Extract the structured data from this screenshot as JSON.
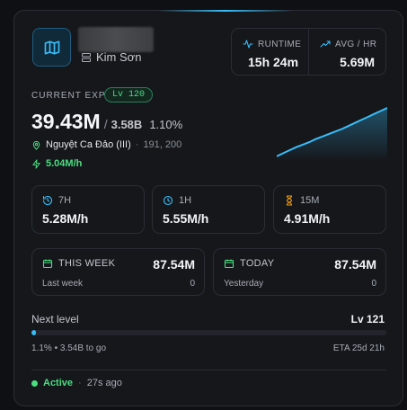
{
  "header": {
    "server_name": "Kim Sơn",
    "icons": {
      "map": "map-icon",
      "server": "server-icon"
    }
  },
  "stats": {
    "runtime_label": "RUNTIME",
    "runtime_value": "15h 24m",
    "avg_label": "AVG / HR",
    "avg_value": "5.69M"
  },
  "exp": {
    "label": "CURRENT EXP",
    "level": "Lv 120",
    "value": "39.43M",
    "slash": "/",
    "max": "3.58B",
    "percent": "1.10%",
    "location": "Nguyệt Ca Đảo (III)",
    "dot": "·",
    "coords": "191, 200",
    "rate": "5.04M/h"
  },
  "sparkline_values": [
    0.04,
    0.1,
    0.16,
    0.22,
    0.27,
    0.32,
    0.38,
    0.43,
    0.48,
    0.53,
    0.58,
    0.64,
    0.7,
    0.76,
    0.82,
    0.88,
    0.94,
    1.0
  ],
  "rates": [
    {
      "label": "7H",
      "value": "5.28M/h",
      "icon": "history-icon"
    },
    {
      "label": "1H",
      "value": "5.55M/h",
      "icon": "clock-icon"
    },
    {
      "label": "15M",
      "value": "4.91M/h",
      "icon": "hourglass-icon"
    }
  ],
  "periods": [
    {
      "label": "THIS WEEK",
      "value": "87.54M",
      "sub_label": "Last week",
      "sub_value": "0",
      "icon": "calendar-icon"
    },
    {
      "label": "TODAY",
      "value": "87.54M",
      "sub_label": "Yesterday",
      "sub_value": "0",
      "icon": "calendar-icon"
    }
  ],
  "next_level": {
    "label": "Next level",
    "level": "Lv 121",
    "progress": 0.011,
    "to_go": "1.1% • 3.54B to go",
    "eta": "ETA 25d 21h"
  },
  "status": {
    "state": "Active",
    "sep": "·",
    "ago": "27s ago"
  },
  "colors": {
    "accent": "#38bdf8",
    "positive": "#4ade80",
    "card_bg": "#15171b",
    "border": "#2a2e34"
  }
}
